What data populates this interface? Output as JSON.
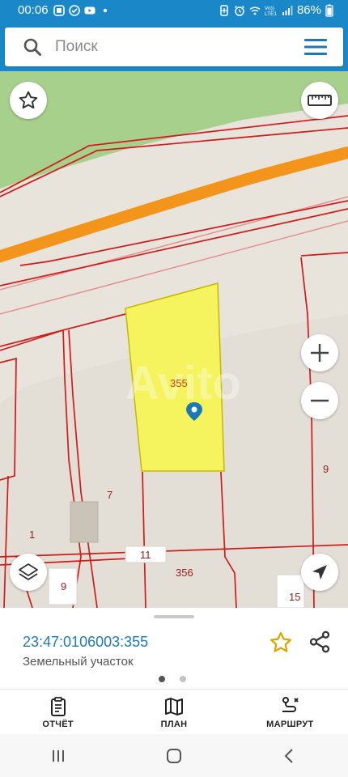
{
  "status_bar": {
    "time": "00:06",
    "battery": "86%",
    "network": "VoLTE1",
    "icons": [
      "alarm-icon",
      "notification-icon",
      "check-circle-icon",
      "youtube-icon",
      "dot-icon",
      "battery-saver-icon",
      "alarm-clock-icon",
      "wifi-icon",
      "signal-icon",
      "battery-icon"
    ]
  },
  "search": {
    "placeholder": "Поиск"
  },
  "map": {
    "labels": {
      "parcel_355": "355",
      "parcel_7": "7",
      "parcel_1": "1",
      "parcel_11": "11",
      "parcel_356": "356",
      "parcel_9_right": "9",
      "parcel_9_left": "9",
      "parcel_15": "15"
    },
    "watermark": "Avito",
    "colors": {
      "green_area": "#a8d08d",
      "road": "#f3951b",
      "boundary": "#d01b1b",
      "selected_parcel": "#f5f35e",
      "background": "#e8e3db"
    }
  },
  "panel": {
    "cadastral_number": "23:47:0106003:355",
    "object_type": "Земельный участок",
    "page_count": 2,
    "active_page": 1
  },
  "bottom_nav": [
    {
      "label": "ОТЧЁТ",
      "icon": "report-icon"
    },
    {
      "label": "ПЛАН",
      "icon": "map-plan-icon"
    },
    {
      "label": "МАРШРУТ",
      "icon": "route-icon"
    }
  ],
  "system_nav": [
    "recents-icon",
    "home-icon",
    "back-icon"
  ],
  "accent_color": "#1a87c8"
}
